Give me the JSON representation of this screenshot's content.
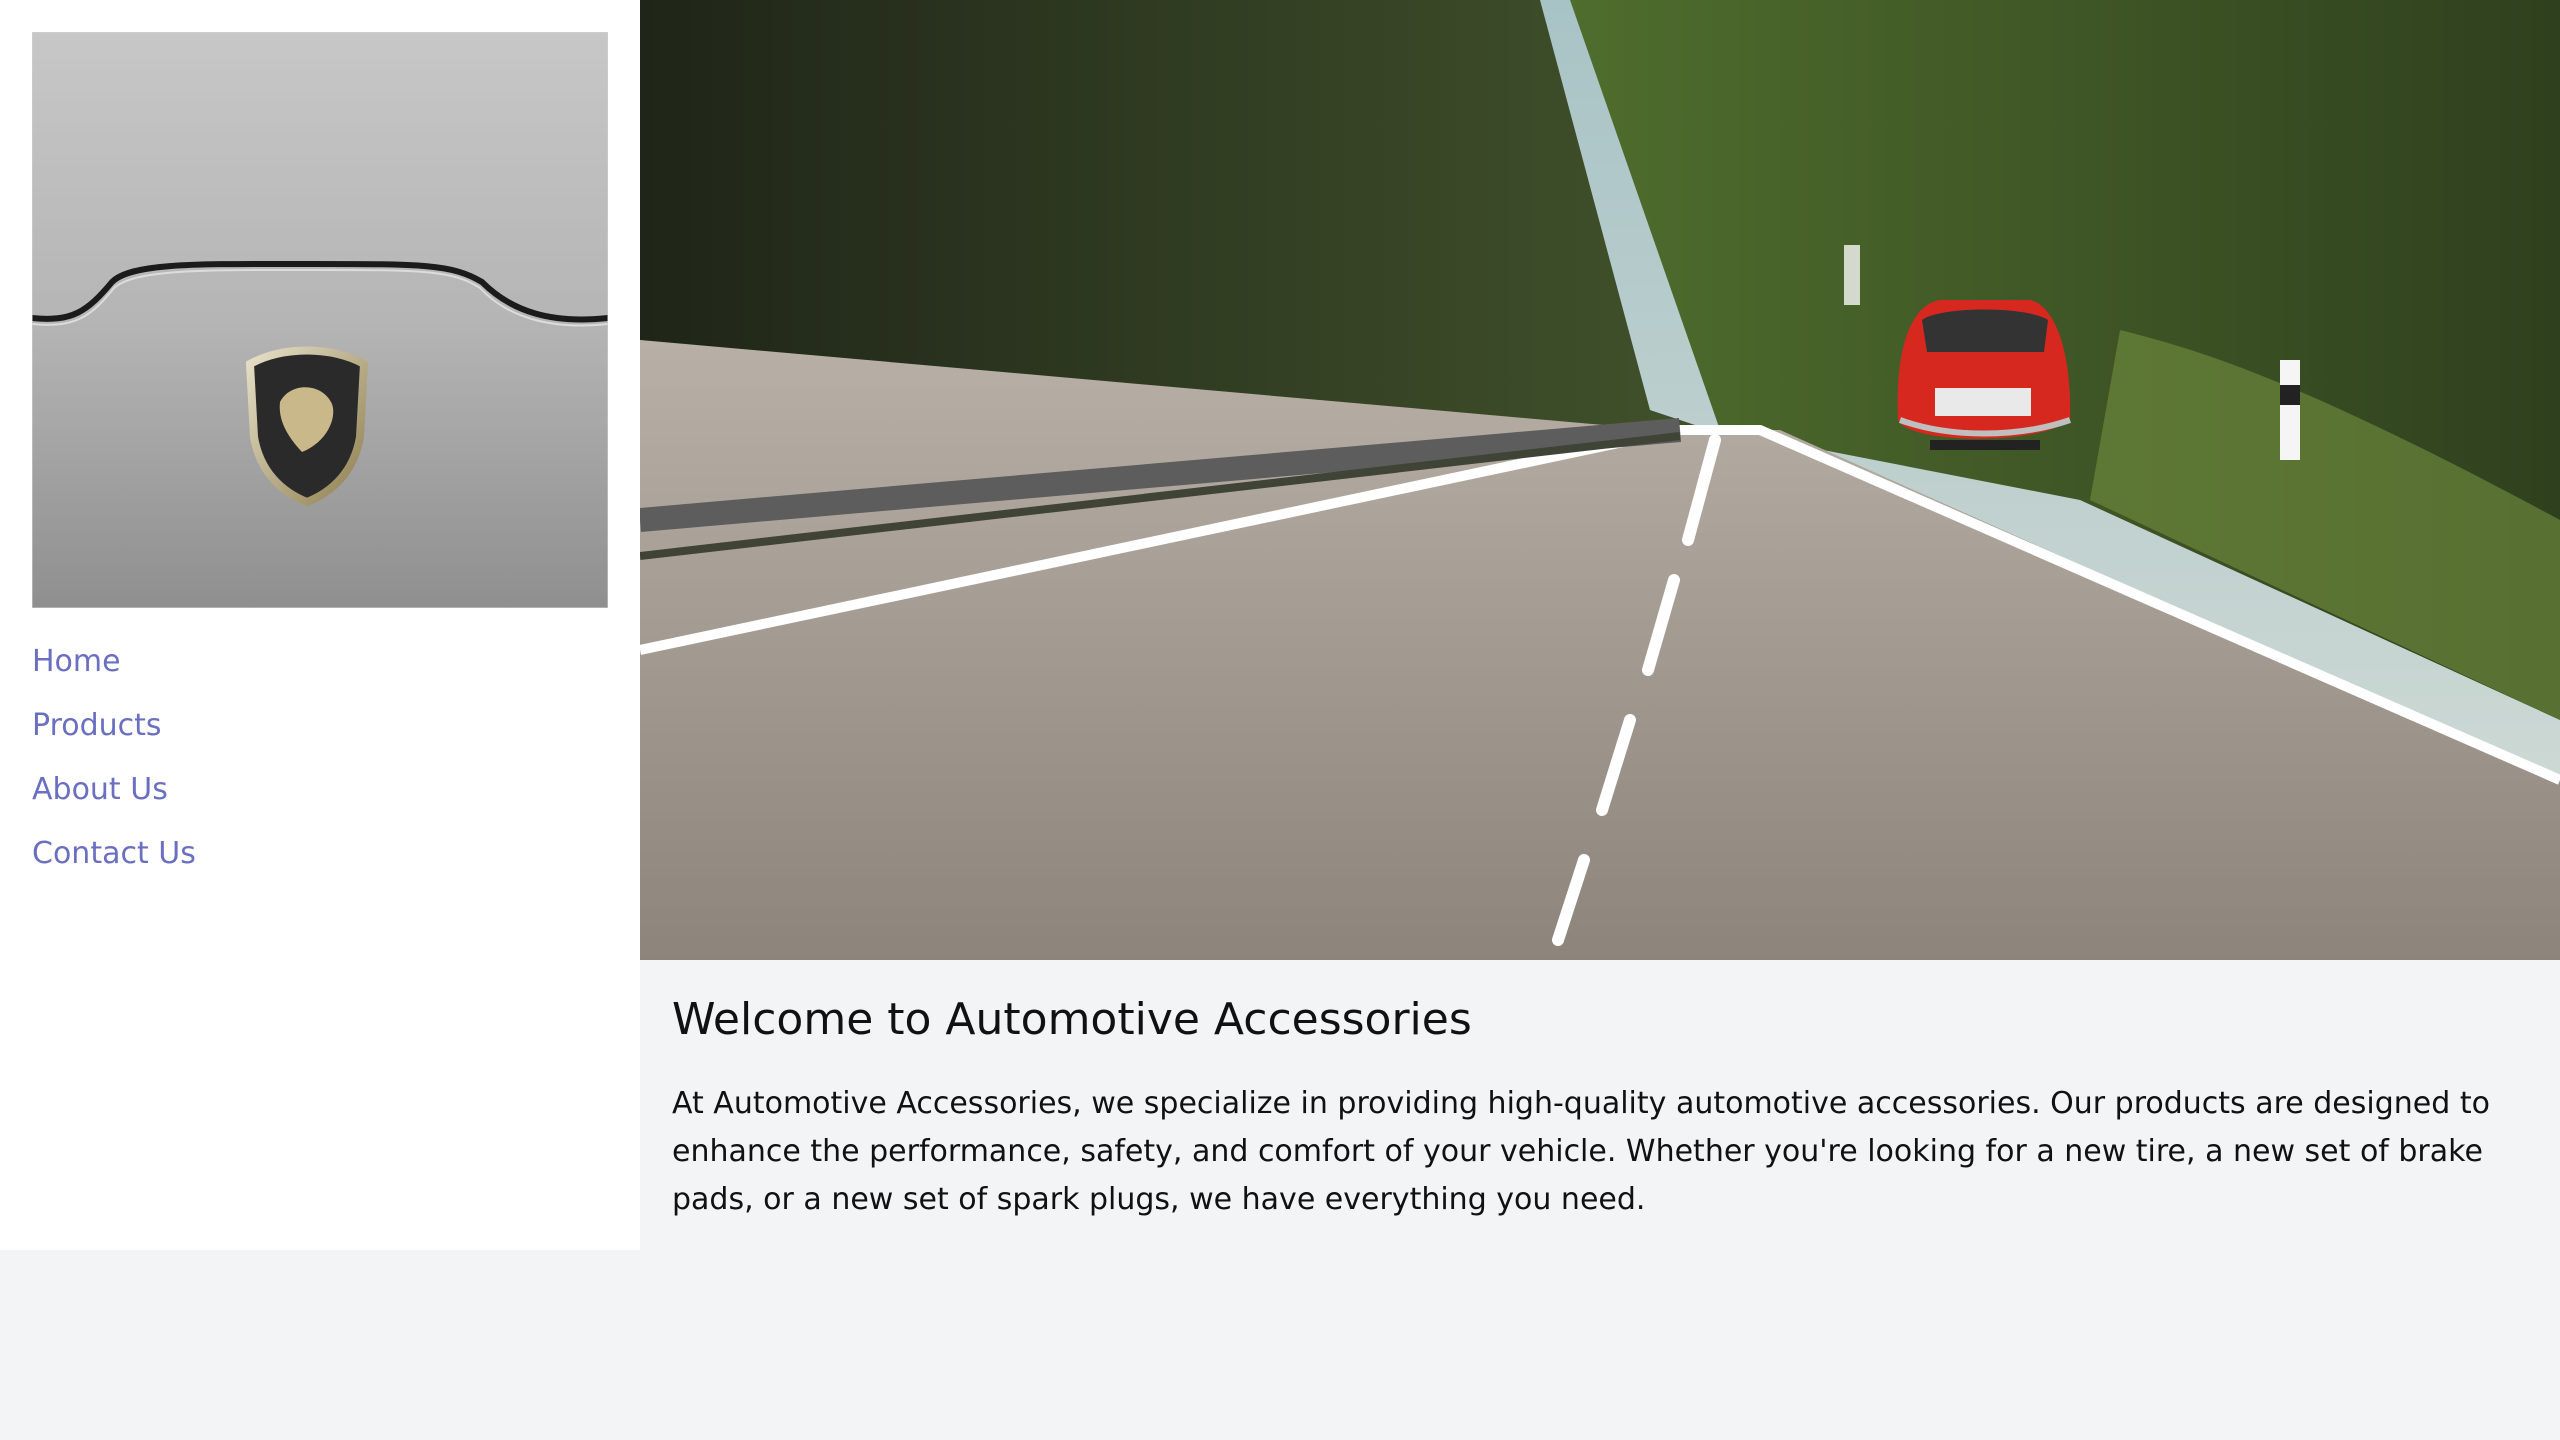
{
  "sidebar": {
    "logo": {
      "icon": "lamborghini-badge-icon",
      "alt": "Car logo"
    },
    "nav": [
      {
        "label": "Home"
      },
      {
        "label": "Products"
      },
      {
        "label": "About Us"
      },
      {
        "label": "Contact Us"
      }
    ]
  },
  "hero": {
    "icon": "road-car-photo-icon",
    "alt": "Red car on a country road"
  },
  "main": {
    "title": "Welcome to Automotive Accessories",
    "description": "At Automotive Accessories, we specialize in providing high-quality automotive accessories. Our products are designed to enhance the performance, safety, and comfort of your vehicle. Whether you're looking for a new tire, a new set of brake pads, or a new set of spark plugs, we have everything you need."
  },
  "colors": {
    "background": "#f3f4f6",
    "sidebar_background": "#ffffff",
    "link": "#6b6fc2",
    "text": "#111111"
  }
}
